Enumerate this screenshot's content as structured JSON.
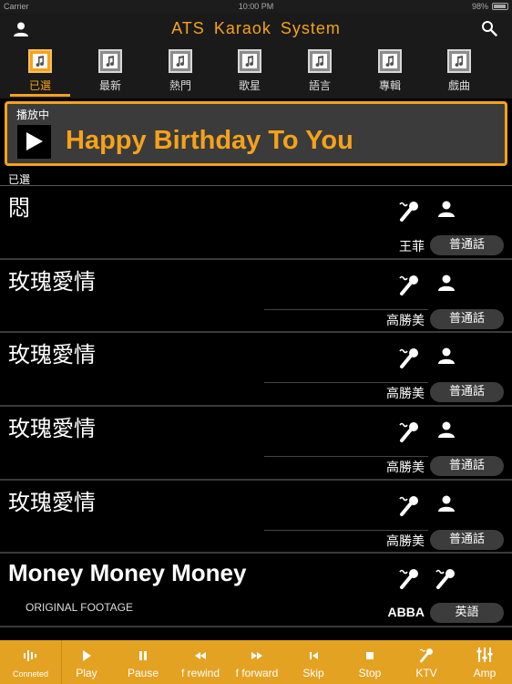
{
  "status_bar": {
    "carrier": "Carrier",
    "time": "10:00 PM",
    "battery": "98%"
  },
  "header": {
    "title": "ATS  Karaok  System",
    "left_icon": "user-icon",
    "right_icon": "search-icon"
  },
  "tabs": [
    {
      "label": "已選",
      "active": true
    },
    {
      "label": "最新",
      "active": false
    },
    {
      "label": "熱門",
      "active": false
    },
    {
      "label": "歌星",
      "active": false
    },
    {
      "label": "語言",
      "active": false
    },
    {
      "label": "專輯",
      "active": false
    },
    {
      "label": "戲曲",
      "active": false
    }
  ],
  "now_playing": {
    "label": "播放中",
    "song": "Happy Birthday To You"
  },
  "section_label": "已選",
  "songs": [
    {
      "title": "悶",
      "artist": "王菲",
      "language": "普通話",
      "subtitle": ""
    },
    {
      "title": "玫瑰愛情",
      "artist": "高勝美",
      "language": "普通話",
      "subtitle": ""
    },
    {
      "title": "玫瑰愛情",
      "artist": "高勝美",
      "language": "普通話",
      "subtitle": ""
    },
    {
      "title": "玫瑰愛情",
      "artist": "高勝美",
      "language": "普通話",
      "subtitle": ""
    },
    {
      "title": "玫瑰愛情",
      "artist": "高勝美",
      "language": "普通話",
      "subtitle": ""
    },
    {
      "title": "Money Money Money",
      "artist": "ABBA",
      "language": "英語",
      "subtitle": "ORIGINAL FOOTAGE"
    }
  ],
  "toolbar": {
    "connection": "Conneted",
    "items": [
      "Play",
      "Pause",
      "f rewind",
      "f forward",
      "Skip",
      "Stop",
      "KTV",
      "Amp"
    ]
  },
  "colors": {
    "accent": "#f5a21b",
    "toolbar": "#e4a223",
    "pill": "#3c3c3c"
  }
}
